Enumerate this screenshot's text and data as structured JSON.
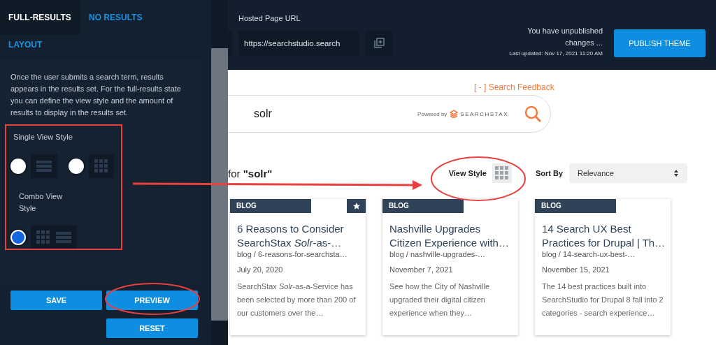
{
  "sidebar": {
    "tabs": [
      {
        "label": "FULL-RESULTS",
        "selected": true
      },
      {
        "label": "NO RESULTS",
        "selected": false
      }
    ],
    "section_tab": "LAYOUT",
    "description": "Once the user submits a search term, results appears in the results set. For the full-results state you can define the view style and the amount of results to display in the results set.",
    "single_view_style": {
      "label": "Single View Style",
      "options": [
        {
          "kind": "list",
          "selected": false
        },
        {
          "kind": "grid",
          "selected": false
        }
      ]
    },
    "combo_view_style": {
      "label": "Combo View Style",
      "options": [
        {
          "kind": "grid-list",
          "selected": true
        }
      ]
    },
    "buttons": [
      "SAVE",
      "PREVIEW",
      "RESET"
    ]
  },
  "header": {
    "url_label": "Hosted Page URL",
    "url_value": "https://searchstudio.search",
    "status": "You have unpublished changes ...",
    "last_updated": "Last updated: Nov 17, 2021 11:20 AM",
    "publish_button": "PUBLISH THEME"
  },
  "preview": {
    "feedback_link": "[ - ] Search Feedback",
    "search_value": "solr",
    "powered_by": "Powered by",
    "brand": "SEARCHSTAX",
    "results_heading": "for **\"solr\"**",
    "view_style_label": "View Style",
    "sort_label": "Sort By",
    "sort_value": "Relevance",
    "cards": [
      {
        "tag": "BLOG",
        "starred": true,
        "title": "6 Reasons to Consider SearchStax *Solr*-as-…",
        "path": "blog / 6-reasons-for-searchsta…",
        "date": "July 20, 2020",
        "snippet": "SearchStax *Solr*-as-a-Service has been selected by more than 200 of our customers over the…"
      },
      {
        "tag": "BLOG",
        "starred": false,
        "title": "Nashville Upgrades Citizen Experience with…",
        "path": "blog / nashville-upgrades-…",
        "date": "November 7, 2021",
        "snippet": "See how the City of Nashville upgraded their digital citizen experience when they…"
      },
      {
        "tag": "BLOG",
        "starred": false,
        "title": "14 Search UX Best Practices for Drupal | Th…",
        "path": "blog / 14-search-ux-best-…",
        "date": "November 15, 2021",
        "snippet": "The 14 best practices built into SearchStudio for Drupal 8 fall into 2 categories - search experience…"
      }
    ]
  }
}
